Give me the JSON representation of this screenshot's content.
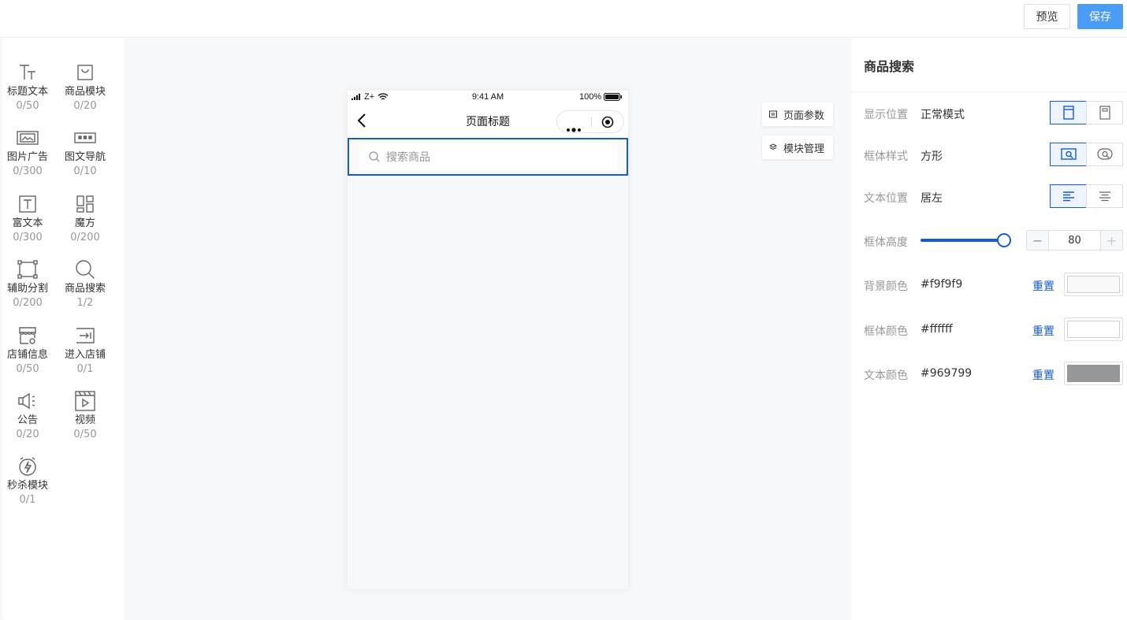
{
  "toolbar": {
    "preview_label": "预览",
    "save_label": "保存"
  },
  "components": [
    {
      "name": "标题文本",
      "count": "0/50",
      "icon": "title-text-icon"
    },
    {
      "name": "商品模块",
      "count": "0/20",
      "icon": "goods-bag-icon"
    },
    {
      "name": "图片广告",
      "count": "0/300",
      "icon": "image-ad-icon"
    },
    {
      "name": "图文导航",
      "count": "0/10",
      "icon": "image-nav-icon"
    },
    {
      "name": "富文本",
      "count": "0/300",
      "icon": "rich-text-icon"
    },
    {
      "name": "魔方",
      "count": "0/200",
      "icon": "cube-layout-icon"
    },
    {
      "name": "辅助分割",
      "count": "0/200",
      "icon": "divider-icon"
    },
    {
      "name": "商品搜索",
      "count": "1/2",
      "icon": "search-icon"
    },
    {
      "name": "店铺信息",
      "count": "0/50",
      "icon": "store-info-icon"
    },
    {
      "name": "进入店铺",
      "count": "0/1",
      "icon": "enter-store-icon"
    },
    {
      "name": "公告",
      "count": "0/20",
      "icon": "announcement-icon"
    },
    {
      "name": "视频",
      "count": "0/50",
      "icon": "video-icon"
    },
    {
      "name": "秒杀模块",
      "count": "0/1",
      "icon": "flash-sale-icon"
    }
  ],
  "phone": {
    "signal": "Z+",
    "time": "9:41 AM",
    "battery": "100%",
    "page_title": "页面标题",
    "search_placeholder": "搜索商品"
  },
  "side_tabs": {
    "page_params": "页面参数",
    "module_manage": "模块管理"
  },
  "panel": {
    "title": "商品搜索",
    "display_position": {
      "label": "显示位置",
      "value": "正常模式"
    },
    "box_style": {
      "label": "框体样式",
      "value": "方形"
    },
    "text_position": {
      "label": "文本位置",
      "value": "居左"
    },
    "box_height": {
      "label": "框体高度",
      "value": "80",
      "minus": "−",
      "plus": "+"
    },
    "bg_color": {
      "label": "背景颜色",
      "value": "#f9f9f9",
      "reset": "重置",
      "color": "#f9f9f9"
    },
    "box_color": {
      "label": "框体颜色",
      "value": "#ffffff",
      "reset": "重置",
      "color": "#ffffff"
    },
    "text_color": {
      "label": "文本颜色",
      "value": "#969799",
      "reset": "重置",
      "color": "#969799"
    }
  },
  "colors": {
    "accent": "#155bd4",
    "save_button": "#4a9cf6",
    "muted_text": "#969799"
  }
}
